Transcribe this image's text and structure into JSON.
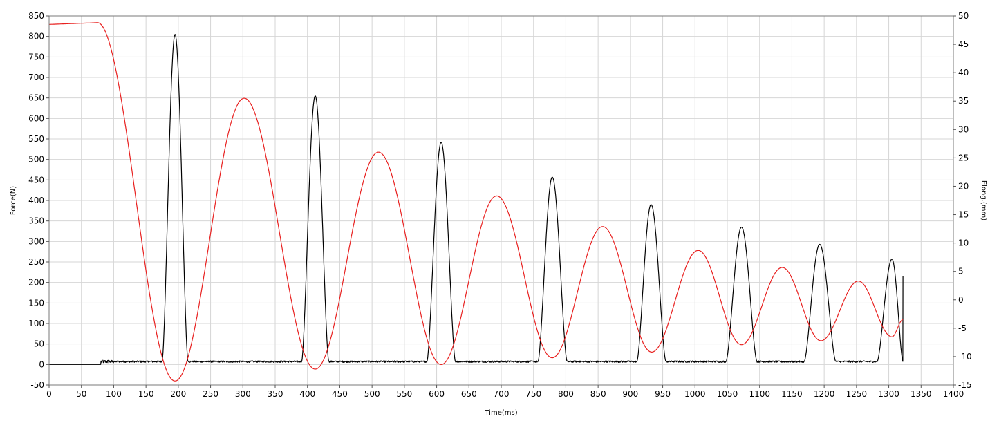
{
  "chart_data": {
    "type": "line",
    "title": "",
    "xlabel": "Time(ms)",
    "ylabel": "Force(N)",
    "y2label": "Elong.(mm)",
    "xlim": [
      0,
      1400
    ],
    "ylim": [
      -50,
      850
    ],
    "y2lim": [
      -15,
      50
    ],
    "x_ticks": [
      0,
      50,
      100,
      150,
      200,
      250,
      300,
      350,
      400,
      450,
      500,
      550,
      600,
      650,
      700,
      750,
      800,
      850,
      900,
      950,
      1000,
      1050,
      1100,
      1150,
      1200,
      1250,
      1300,
      1350,
      1400
    ],
    "y_ticks": [
      -50,
      0,
      50,
      100,
      150,
      200,
      250,
      300,
      350,
      400,
      450,
      500,
      550,
      600,
      650,
      700,
      750,
      800,
      850
    ],
    "y2_ticks": [
      -15,
      -10,
      -5,
      0,
      5,
      10,
      15,
      20,
      25,
      30,
      35,
      40,
      45,
      50
    ],
    "grid": true,
    "legend": "none",
    "series": [
      {
        "axis": "left",
        "color": "#000000",
        "baseline": 7,
        "noise_start": 80,
        "end_x": 1322,
        "end_spike": 215,
        "peaks": [
          {
            "x": 195,
            "y": 805,
            "start": 175,
            "end": 215
          },
          {
            "x": 412,
            "y": 655,
            "start": 391,
            "end": 433
          },
          {
            "x": 607,
            "y": 542,
            "start": 585,
            "end": 629
          },
          {
            "x": 779,
            "y": 457,
            "start": 757,
            "end": 802
          },
          {
            "x": 932,
            "y": 390,
            "start": 910,
            "end": 955
          },
          {
            "x": 1072,
            "y": 335,
            "start": 1048,
            "end": 1096
          },
          {
            "x": 1193,
            "y": 293,
            "start": 1169,
            "end": 1218
          },
          {
            "x": 1305,
            "y": 257,
            "start": 1282,
            "end": 1322
          }
        ]
      },
      {
        "axis": "right",
        "color": "#e8201f",
        "points": [
          [
            0,
            48.5
          ],
          [
            75,
            48.8
          ],
          [
            195,
            -14.3
          ],
          [
            302,
            35.5
          ],
          [
            412,
            -12.2
          ],
          [
            510,
            26
          ],
          [
            607,
            -11.4
          ],
          [
            693,
            18.3
          ],
          [
            779,
            -10.2
          ],
          [
            857,
            12.9
          ],
          [
            933,
            -9.2
          ],
          [
            1005,
            8.7
          ],
          [
            1072,
            -7.9
          ],
          [
            1135,
            5.7
          ],
          [
            1195,
            -7.2
          ],
          [
            1253,
            3.3
          ],
          [
            1305,
            -6.5
          ],
          [
            1322,
            -3.5
          ]
        ]
      }
    ]
  }
}
